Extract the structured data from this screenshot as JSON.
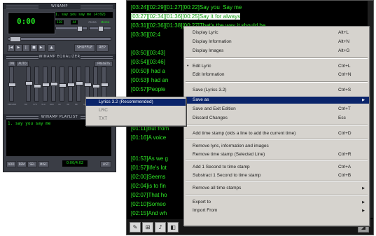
{
  "winamp": {
    "title": "WINAMP",
    "time": "0:00",
    "track": "1. say you say me (4:02)",
    "kbps": "128",
    "khz": "44",
    "mono": "mono",
    "stereo": "stereo",
    "controls": [
      "|◀",
      "▶",
      "||",
      "■",
      "▶|",
      "▲"
    ],
    "shuffle": "SHUFFLE",
    "repeat": "REP",
    "eq_title": "WINAMP EQUALIZER",
    "eq_on": "ON",
    "eq_auto": "AUTO",
    "eq_presets": "PRESETS",
    "eq_bands": [
      "PREAMP",
      "60",
      "170",
      "310",
      "600",
      "1K",
      "3K",
      "6K",
      "12K",
      "14K",
      "16K"
    ],
    "eq_levels": [
      0.5,
      0.45,
      0.55,
      0.5,
      0.48,
      0.52,
      0.5,
      0.46,
      0.5,
      0.55,
      0.5
    ],
    "pl_title": "WINAMP PLAYLIST",
    "pl_items": [
      "1. say you say me"
    ],
    "pl_buttons": [
      "ADD",
      "REM",
      "SEL",
      "MISC",
      "LIST"
    ],
    "pl_time": "0:00/4:02"
  },
  "lyrics": {
    "lines": [
      "[03:24][02:29][01:27][00:22]Say you  Say me",
      "[03:27][02:34][01:36][00:25]Say it for always",
      "[03:31][02:36][01:38][00:27]That's the way it should be",
      "[03:36][02:4",
      "",
      "[03:50][03:43]",
      "[03:54][03:46]",
      "[00:50]I had a",
      "[00:53]I had an",
      "[00:57]People",
      "",
      "",
      "",
      "",
      "[01:11]But from",
      "[01:16]A voice",
      "",
      "[01:53]As we g",
      "[01:57]life's lot",
      "[02:00]Seems",
      "[02:04]is to fin",
      "[02:07]That ho",
      "[02:10]Someo",
      "[02:15]And wh"
    ],
    "toolbar": [
      "✎",
      "⊞",
      "♪",
      "◧"
    ],
    "corner": "◢"
  },
  "menu": {
    "items": [
      {
        "label": "Display Lyric",
        "shortcut": "Alt+L"
      },
      {
        "label": "Display Information",
        "shortcut": "Alt+N"
      },
      {
        "label": "Display Images",
        "shortcut": "Alt+G"
      },
      {
        "label": "Edit Lyric",
        "shortcut": "Ctrl+L",
        "checked": true
      },
      {
        "label": "Edit Information",
        "shortcut": "Ctrl+N"
      },
      {
        "label": "Save (Lyrics 3.2)",
        "shortcut": "Ctrl+S"
      },
      {
        "label": "Save as",
        "shortcut": "",
        "submenu": true,
        "selected": true
      },
      {
        "label": "Save and Exit Edition",
        "shortcut": "Ctrl+T"
      },
      {
        "label": "Discard Changes",
        "shortcut": "Esc"
      },
      {
        "label": "Add time stamp (olds a line to add the current time)",
        "shortcut": "Ctrl+D"
      },
      {
        "label": "Remove lyric, information and images",
        "shortcut": ""
      },
      {
        "label": "Remove time stamp (Selected Line)",
        "shortcut": "Ctrl+R"
      },
      {
        "label": "Add 1 Second to time stamp",
        "shortcut": "Ctrl+A"
      },
      {
        "label": "Substract 1 Second to time stamp",
        "shortcut": "Ctrl+B"
      },
      {
        "label": "Remove all time stamps",
        "shortcut": "",
        "submenu": true
      },
      {
        "label": "Export to",
        "shortcut": "",
        "submenu": true
      },
      {
        "label": "Import From",
        "shortcut": "",
        "submenu": true
      }
    ],
    "bullet": "•",
    "arrow": "▶"
  },
  "submenu": {
    "items": [
      {
        "label": "Lyrics 3.2 (Recommended)",
        "selected": true
      },
      {
        "label": "LRC",
        "disabled": true
      },
      {
        "label": "TXT",
        "disabled": true
      }
    ]
  }
}
